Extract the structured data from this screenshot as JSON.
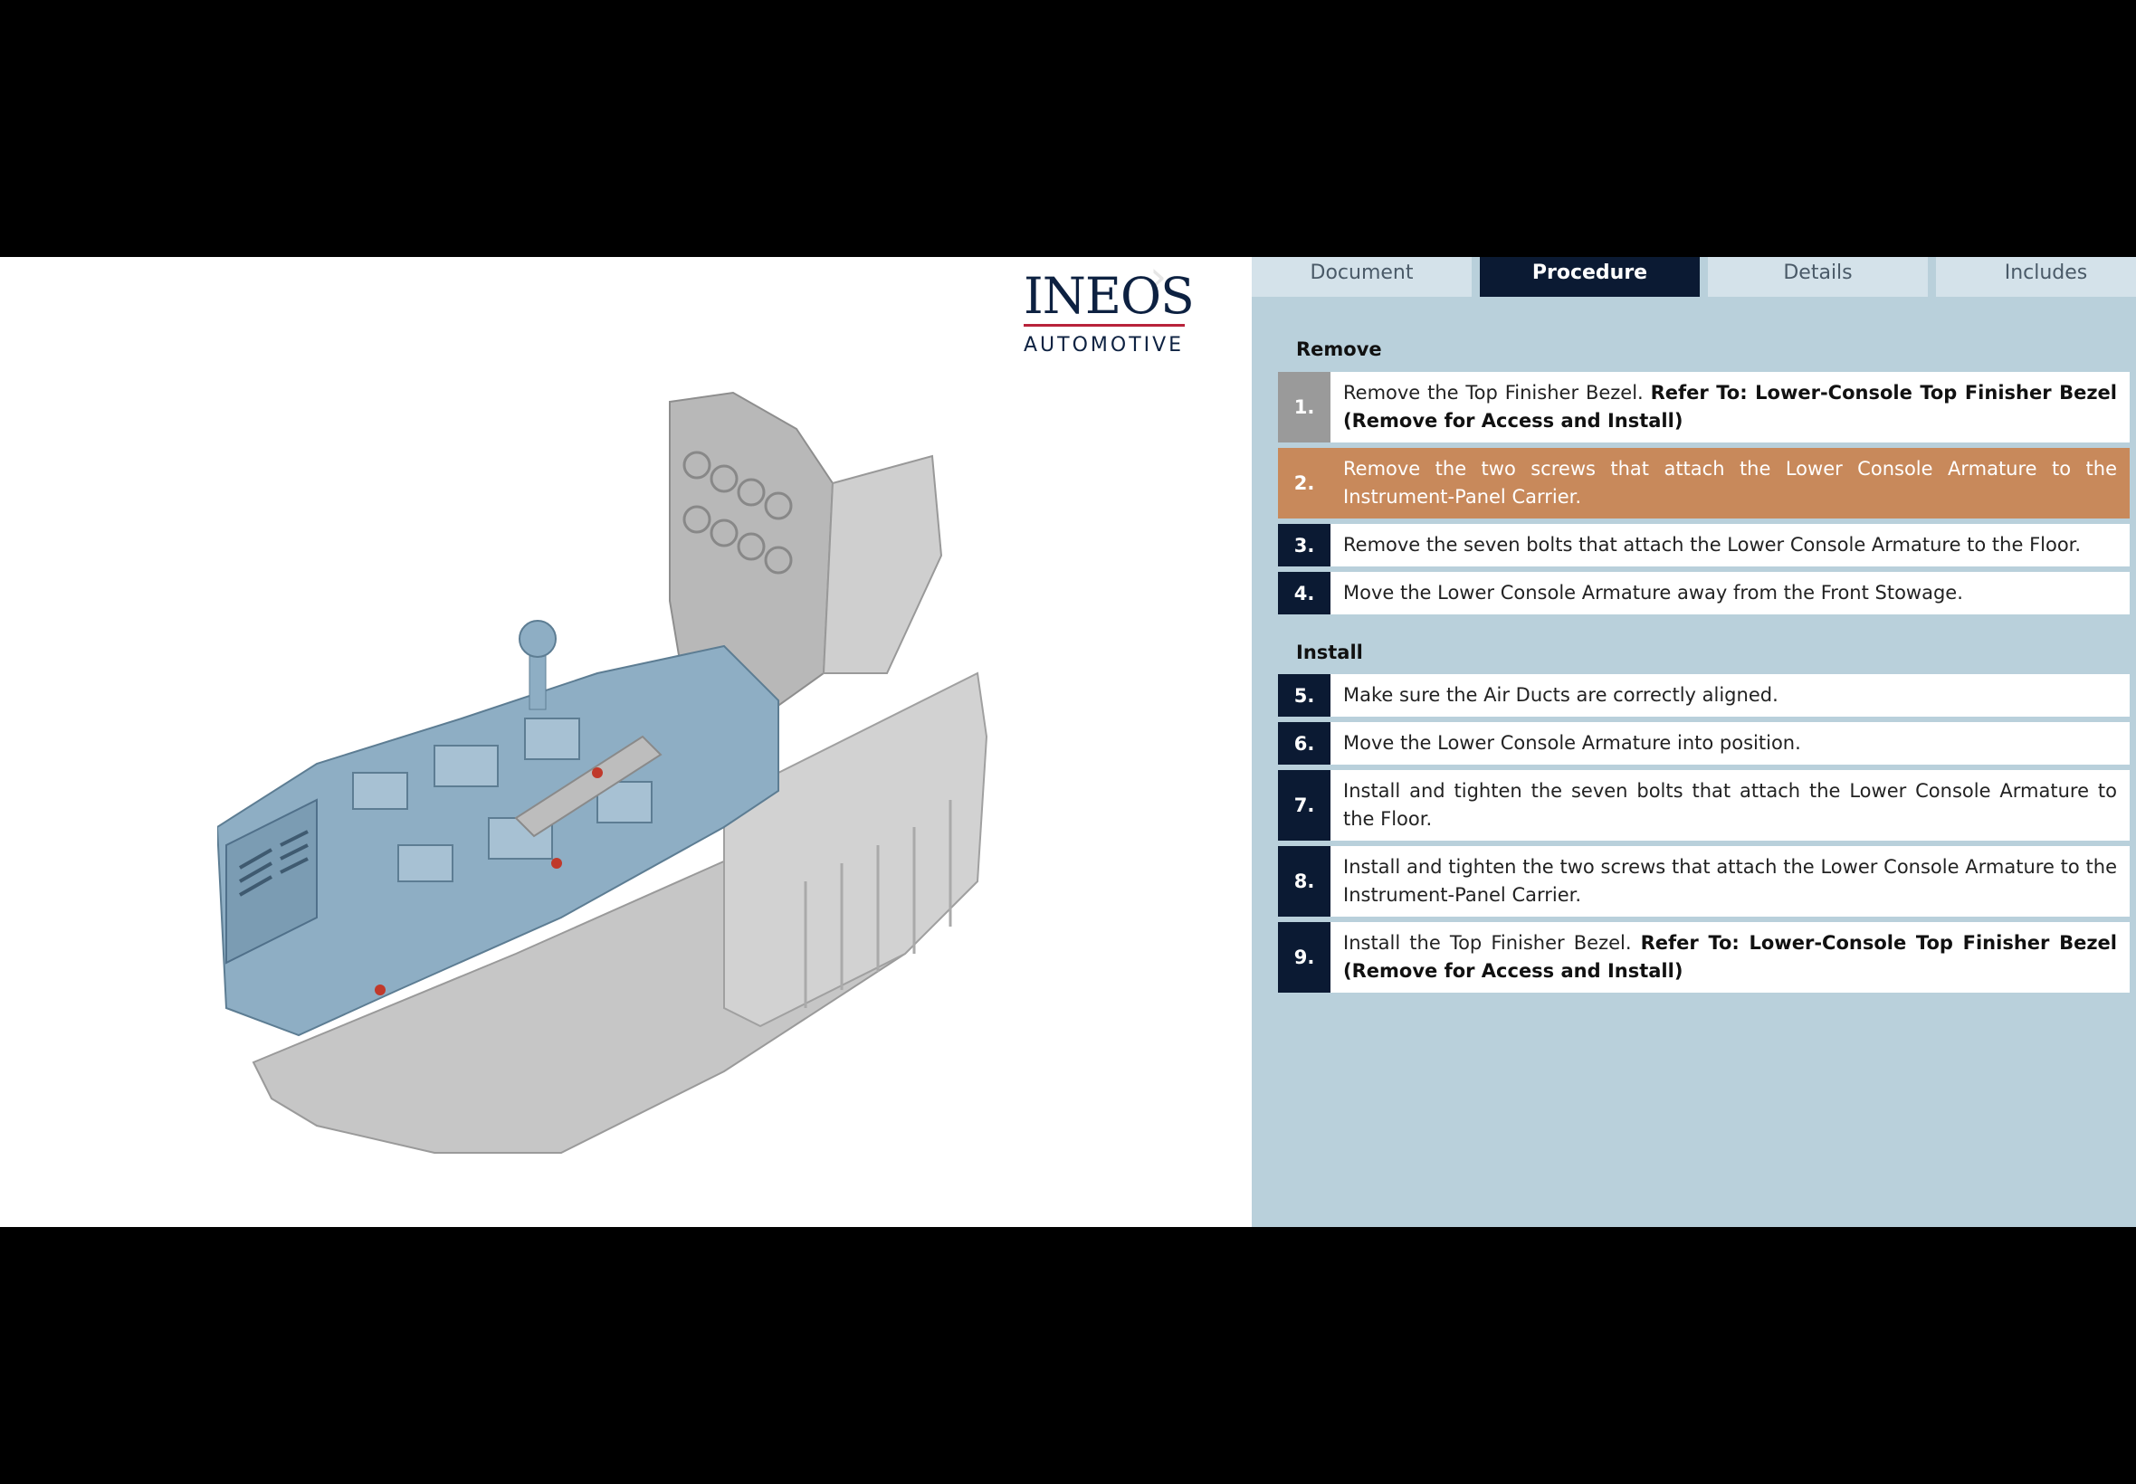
{
  "logo": {
    "name": "INEOS",
    "sub": "AUTOMOTIVE"
  },
  "tabs": [
    {
      "label": "Document"
    },
    {
      "label": "Procedure"
    },
    {
      "label": "Details"
    },
    {
      "label": "Includes"
    }
  ],
  "sections": {
    "remove": "Remove",
    "install": "Install"
  },
  "steps": [
    {
      "num": "1.",
      "text": "Remove the Top Finisher Bezel. ",
      "ref": "Refer To: Lower-Console Top Finisher Bezel (Remove for Access and Install)"
    },
    {
      "num": "2.",
      "text": "Remove the two screws that attach the Lower Console Armature to the Instrument-Panel Carrier."
    },
    {
      "num": "3.",
      "text": "Remove the seven bolts that attach the Lower Console Armature to the Floor."
    },
    {
      "num": "4.",
      "text": "Move the Lower Console Armature away from the Front Stowage."
    },
    {
      "num": "5.",
      "text": "Make sure the Air Ducts are correctly aligned."
    },
    {
      "num": "6.",
      "text": "Move the Lower Console Armature into position."
    },
    {
      "num": "7.",
      "text": "Install and tighten the seven bolts that attach the Lower Console Armature to the Floor."
    },
    {
      "num": "8.",
      "text": "Install and tighten the two screws that attach the Lower Console Armature to the Instrument-Panel Carrier."
    },
    {
      "num": "9.",
      "text": "Install the Top Finisher Bezel. ",
      "ref": "Refer To: Lower-Console Top Finisher Bezel (Remove for Access and Install)"
    }
  ],
  "colors": {
    "panel_bg": "#b9d0db",
    "tab_active": "#0b1a33",
    "step_current": "#c8895b",
    "step_done": "#9a9a9a",
    "armature_blue": "#8eaec4",
    "console_grey": "#c4c4c4"
  }
}
